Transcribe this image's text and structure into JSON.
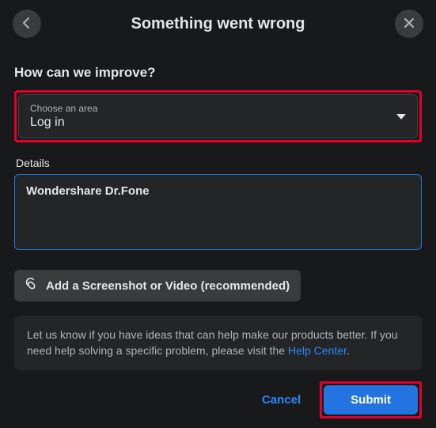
{
  "header": {
    "title": "Something went wrong"
  },
  "section": {
    "heading": "How can we improve?"
  },
  "dropdown": {
    "label": "Choose an area",
    "value": "Log in"
  },
  "details": {
    "label": "Details",
    "value": "Wondershare Dr.Fone"
  },
  "attach": {
    "label": "Add a Screenshot or Video (recommended)"
  },
  "info": {
    "text": "Let us know if you have ideas that can help make our products better. If you need help solving a specific problem, please visit the ",
    "link": "Help Center",
    "tail": "."
  },
  "footer": {
    "cancel": "Cancel",
    "submit": "Submit"
  }
}
